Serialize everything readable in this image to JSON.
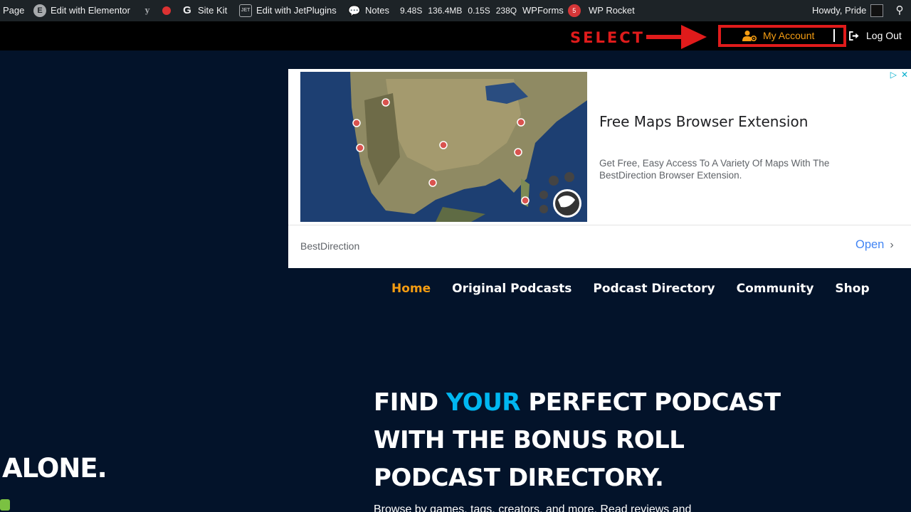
{
  "adminbar": {
    "page": "Page",
    "edit_elementor": "Edit with Elementor",
    "site_kit": "Site Kit",
    "edit_jet": "Edit with JetPlugins",
    "notes": "Notes",
    "perf_time": "9.48S",
    "perf_mem": "136.4MB",
    "perf_db": "0.15S",
    "perf_queries": "238Q",
    "wpforms": "WPForms",
    "wpforms_count": "5",
    "wp_rocket": "WP Rocket",
    "howdy": "Howdy, Pride"
  },
  "header": {
    "annotation": "SELECT",
    "my_account": "My Account",
    "logout": "Log Out"
  },
  "ad": {
    "title": "Free Maps Browser Extension",
    "description": "Get Free, Easy Access To A Variety Of Maps With The BestDirection Browser Extension.",
    "source": "BestDirection",
    "open": "Open"
  },
  "nav": {
    "items": [
      "Home",
      "Original Podcasts",
      "Podcast Directory",
      "Community",
      "Shop"
    ]
  },
  "hero": {
    "line1_pre": "FIND ",
    "line1_hl": "YOUR",
    "line1_post": " PERFECT PODCAST",
    "line2": "WITH THE BONUS ROLL",
    "line3": "PODCAST DIRECTORY.",
    "sub": "Browse by games, tags, creators, and more. Read reviews and",
    "left_fragment": "ALONE."
  },
  "colors": {
    "accent_orange": "#f39c12",
    "accent_blue": "#00b7f1",
    "annotation_red": "#e01b1b",
    "page_bg": "#03132a"
  }
}
